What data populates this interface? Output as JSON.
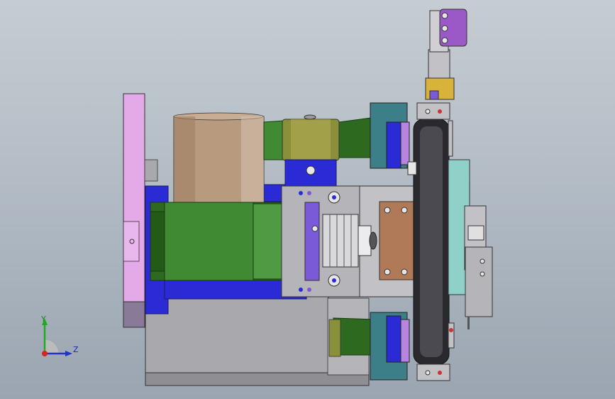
{
  "viewport": {
    "background_top": "#c6ccd3",
    "background_bottom": "#9aa5b1"
  },
  "model": {
    "colors": {
      "pink": "#e3a9e8",
      "tan": "#b89a7e",
      "olive": "#8a8f3a",
      "green_dark": "#2d6a1f",
      "green": "#3f8a33",
      "blue": "#2b2bd6",
      "purple": "#7a5ad8",
      "gray": "#a9a9ad",
      "gray_dark": "#7d7d82",
      "copper": "#b07a58",
      "black": "#2a2a2e",
      "teal": "#3d7f88",
      "yellow": "#d9b23a",
      "violet": "#9b59c8"
    }
  },
  "triad": {
    "y_label": "Y",
    "z_label": "Z",
    "icons": [
      "y-axis-arrow-icon",
      "z-axis-arrow-icon",
      "origin-icon"
    ]
  }
}
